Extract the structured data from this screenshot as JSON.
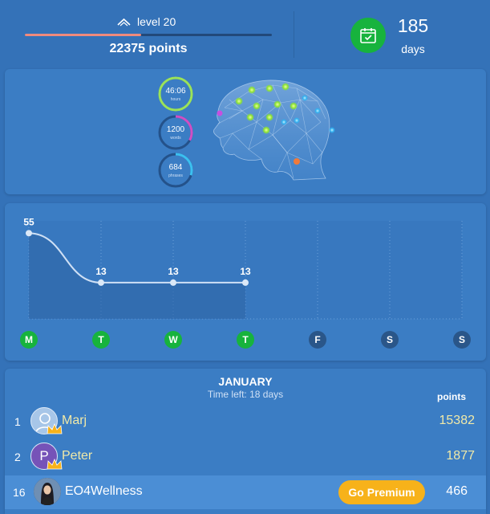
{
  "header": {
    "level": "level 20",
    "level_progress": 0.47,
    "points": "22375 points",
    "streak_days": "185",
    "days_label": "days"
  },
  "stats": {
    "time": {
      "value": "46:06",
      "label": "hours",
      "color": "#9be35a",
      "fraction": 1.0
    },
    "words": {
      "value": "1200",
      "label": "words",
      "color": "#d04fc4",
      "fraction": 0.33
    },
    "phrases": {
      "value": "684",
      "label": "phrases",
      "color": "#3bc0f0",
      "fraction": 0.3
    }
  },
  "chart_data": {
    "type": "line",
    "categories": [
      "M",
      "T",
      "W",
      "T",
      "F",
      "S",
      "S"
    ],
    "values": [
      55,
      13,
      13,
      13,
      null,
      null,
      null
    ],
    "day_labels": [
      "55",
      "13",
      "13",
      "13"
    ],
    "active_days": [
      true,
      true,
      true,
      true,
      false,
      false,
      false
    ],
    "ylim": [
      0,
      60
    ],
    "active_color": "#17b33d",
    "inactive_color": "#2a5689"
  },
  "leaderboard": {
    "month": "JANUARY",
    "time_left": "Time left: 18 days",
    "points_header": "points",
    "rows": [
      {
        "rank": "1",
        "name": "Marj",
        "points": "15382",
        "avatar_letter": ""
      },
      {
        "rank": "2",
        "name": "Peter",
        "points": "1877",
        "avatar_letter": "P"
      },
      {
        "rank": "16",
        "name": "EO4Wellness",
        "points": "466",
        "avatar_letter": ""
      }
    ],
    "premium_button": "Go Premium"
  }
}
